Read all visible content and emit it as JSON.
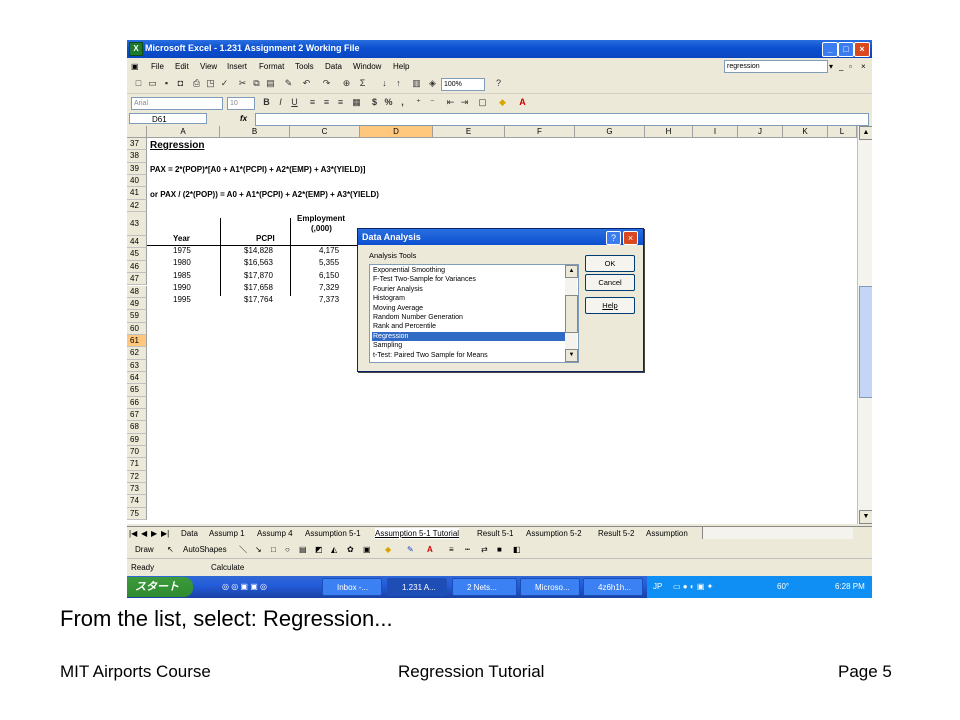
{
  "window": {
    "title": "Microsoft Excel - 1.231 Assignment 2 Working File",
    "app_icon": "excel-icon"
  },
  "menu": {
    "items": [
      "File",
      "Edit",
      "View",
      "Insert",
      "Format",
      "Tools",
      "Data",
      "Window",
      "Help"
    ],
    "help_query": "regression"
  },
  "toolbar": {
    "zoom": "100%"
  },
  "format_toolbar": {
    "font": "Arial",
    "size": "10"
  },
  "formula_bar": {
    "cell_ref": "D61",
    "fx": "fx"
  },
  "sheet": {
    "columns": [
      "A",
      "B",
      "C",
      "D",
      "E",
      "F",
      "G",
      "H",
      "I",
      "J",
      "K",
      "L"
    ],
    "selected_column": "D",
    "selected_row": "61",
    "rows": [
      "37",
      "38",
      "39",
      "40",
      "41",
      "42",
      "43",
      "44",
      "45",
      "46",
      "47",
      "48",
      "49",
      "59",
      "60",
      "61",
      "62",
      "63",
      "64",
      "65",
      "66",
      "67",
      "68",
      "69",
      "70",
      "71",
      "72",
      "73",
      "74",
      "75"
    ],
    "text": {
      "r37a": "Regression",
      "r39": "PAX = 2*(POP)*[A0 + A1*(PCPI) + A2*(EMP) + A3*(YIELD)]",
      "r41": "or PAX / (2*(POP)) = A0 + A1*(PCPI) + A2*(EMP) + A3*(YIELD)",
      "emp_head1": "Employment",
      "emp_head2": "(,000)",
      "year_head": "Year",
      "pcpi_head": "PCPI"
    },
    "data_rows": [
      {
        "year": "1975",
        "pcpi": "$14,828",
        "emp": "4,175"
      },
      {
        "year": "1980",
        "pcpi": "$16,563",
        "emp": "5,355"
      },
      {
        "year": "1985",
        "pcpi": "$17,870",
        "emp": "6,150"
      },
      {
        "year": "1990",
        "pcpi": "$17,658",
        "emp": "7,329"
      },
      {
        "year": "1995",
        "pcpi": "$17,764",
        "emp": "7,373"
      }
    ]
  },
  "sheet_tabs": [
    "Data",
    "Assump 1",
    "Assump 4",
    "Assumption 5-1",
    "Assumption 5-1 Tutorial",
    "Result 5-1",
    "Assumption 5-2",
    "Result 5-2",
    "Assumption"
  ],
  "active_tab": "Assumption 5-1 Tutorial",
  "drawing": {
    "draw": "Draw",
    "autoshapes": "AutoShapes"
  },
  "status": {
    "left": "Ready",
    "mode": "Calculate"
  },
  "taskbar": {
    "start": "スタート",
    "buttons": [
      "Inbox -...",
      "1.231 A...",
      "2 Nets...",
      "Microso...",
      "4z6h1h..."
    ],
    "lang": "JP",
    "temp": "60°",
    "clock": "6:28 PM"
  },
  "dialog": {
    "title": "Data Analysis",
    "label": "Analysis Tools",
    "items": [
      "Exponential Smoothing",
      "F-Test Two-Sample for Variances",
      "Fourier Analysis",
      "Histogram",
      "Moving Average",
      "Random Number Generation",
      "Rank and Percentile",
      "Regression",
      "Sampling",
      "t-Test: Paired Two Sample for Means"
    ],
    "selected_index": 7,
    "ok": "OK",
    "cancel": "Cancel",
    "help": "Help"
  },
  "caption": "From the list, select:  Regression...",
  "footer": {
    "left": "MIT Airports Course",
    "center": "Regression Tutorial",
    "right": "Page 5"
  }
}
